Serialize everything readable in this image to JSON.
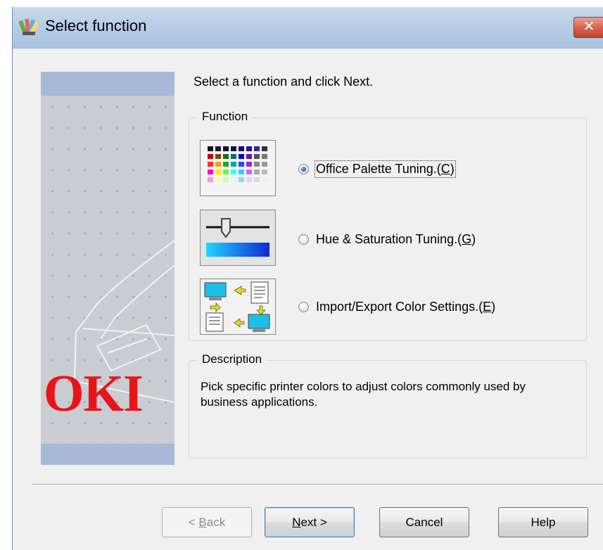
{
  "window": {
    "title": "Select function",
    "close_label": "✕"
  },
  "instruction": "Select a function and click Next.",
  "function_group": {
    "legend": "Function",
    "options": [
      {
        "label": "Office Palette Tuning.",
        "accel": "C",
        "selected": true,
        "icon": "color-palette-icon"
      },
      {
        "label": "Hue & Saturation Tuning.",
        "accel": "G",
        "selected": false,
        "icon": "hue-saturation-slider-icon"
      },
      {
        "label": "Import/Export Color Settings.",
        "accel": "E",
        "selected": false,
        "icon": "import-export-icon"
      }
    ]
  },
  "description_group": {
    "legend": "Description",
    "text": "Pick specific printer colors to adjust colors commonly used by business applications."
  },
  "brand": {
    "logo_text": "OKI",
    "logo_color": "#e8141a"
  },
  "buttons": {
    "back_prefix": "< ",
    "back_accel": "B",
    "back_rest": "ack",
    "next_accel": "N",
    "next_rest": "ext >",
    "cancel": "Cancel",
    "help": "Help"
  },
  "colors": {
    "titlebar": "#b8cde6",
    "dialog_bg": "#f0f0f0",
    "close_button": "#c0432d",
    "accent_band": "#a7b9d6"
  }
}
